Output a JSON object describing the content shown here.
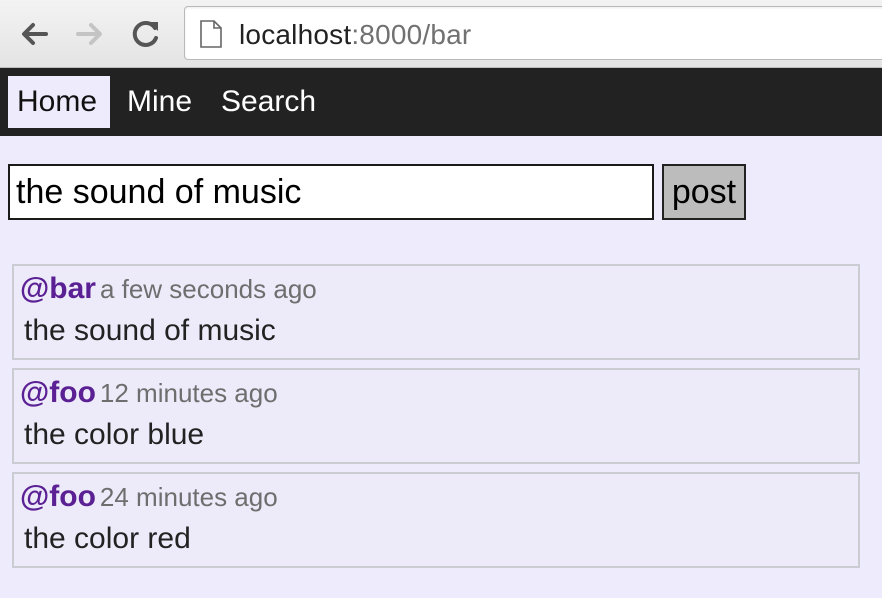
{
  "browser": {
    "url_host": "localhost",
    "url_rest": ":8000/bar"
  },
  "navbar": {
    "items": [
      {
        "label": "Home",
        "active": true
      },
      {
        "label": "Mine",
        "active": false
      },
      {
        "label": "Search",
        "active": false
      }
    ]
  },
  "post_form": {
    "input_value": "the sound of music",
    "button_label": "post"
  },
  "feed": [
    {
      "author": "@bar",
      "time": "a few seconds ago",
      "content": "the sound of music"
    },
    {
      "author": "@foo",
      "time": "12 minutes ago",
      "content": "the color blue"
    },
    {
      "author": "@foo",
      "time": "24 minutes ago",
      "content": "the color red"
    }
  ],
  "colors": {
    "page_bg": "#eeecfc",
    "navbar_bg": "#222222",
    "author": "#5a2094",
    "timestamp": "#6e6e6e"
  }
}
